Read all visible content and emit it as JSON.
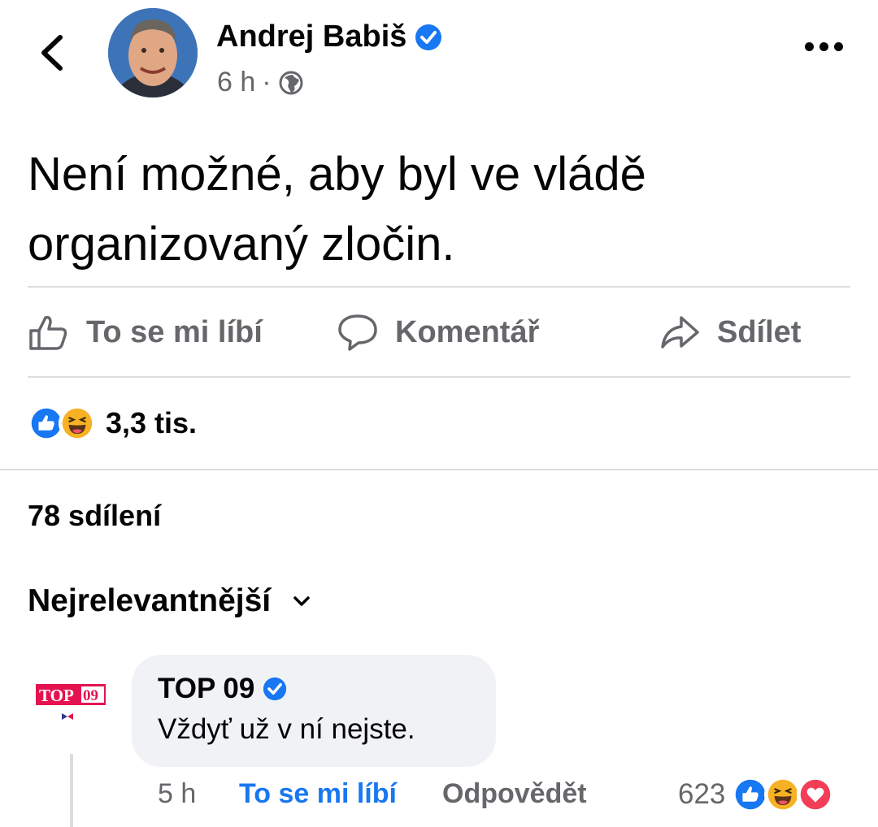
{
  "post": {
    "author": "Andrej Babiš",
    "time": "6 h",
    "separator": "·",
    "audience_icon": "globe-icon",
    "text": "Není možné, aby byl ve vládě organizovaný zločin."
  },
  "actions": {
    "like": "To se mi líbí",
    "comment": "Komentář",
    "share": "Sdílet"
  },
  "stats": {
    "reaction_count": "3,3 tis.",
    "reaction_icons": [
      "like-reaction-icon",
      "haha-reaction-icon"
    ],
    "shares": "78 sdílení"
  },
  "sort": {
    "label": "Nejrelevantnější"
  },
  "comment": {
    "author": "TOP 09",
    "avatar_text": "TOP",
    "avatar_text_2": "09",
    "text": "Vždyť už v ní nejste.",
    "time": "5 h",
    "like": "To se mi líbí",
    "reply": "Odpovědět",
    "reaction_count": "623",
    "reaction_icons": [
      "like-reaction-icon",
      "haha-reaction-icon",
      "love-reaction-icon"
    ]
  },
  "colors": {
    "facebook_blue": "#1877f2",
    "secondary_text": "#65676b",
    "divider": "#dcdde0",
    "bubble": "#f0f2f5",
    "love_red": "#f33e58",
    "haha_yellow": "#f7b125"
  }
}
